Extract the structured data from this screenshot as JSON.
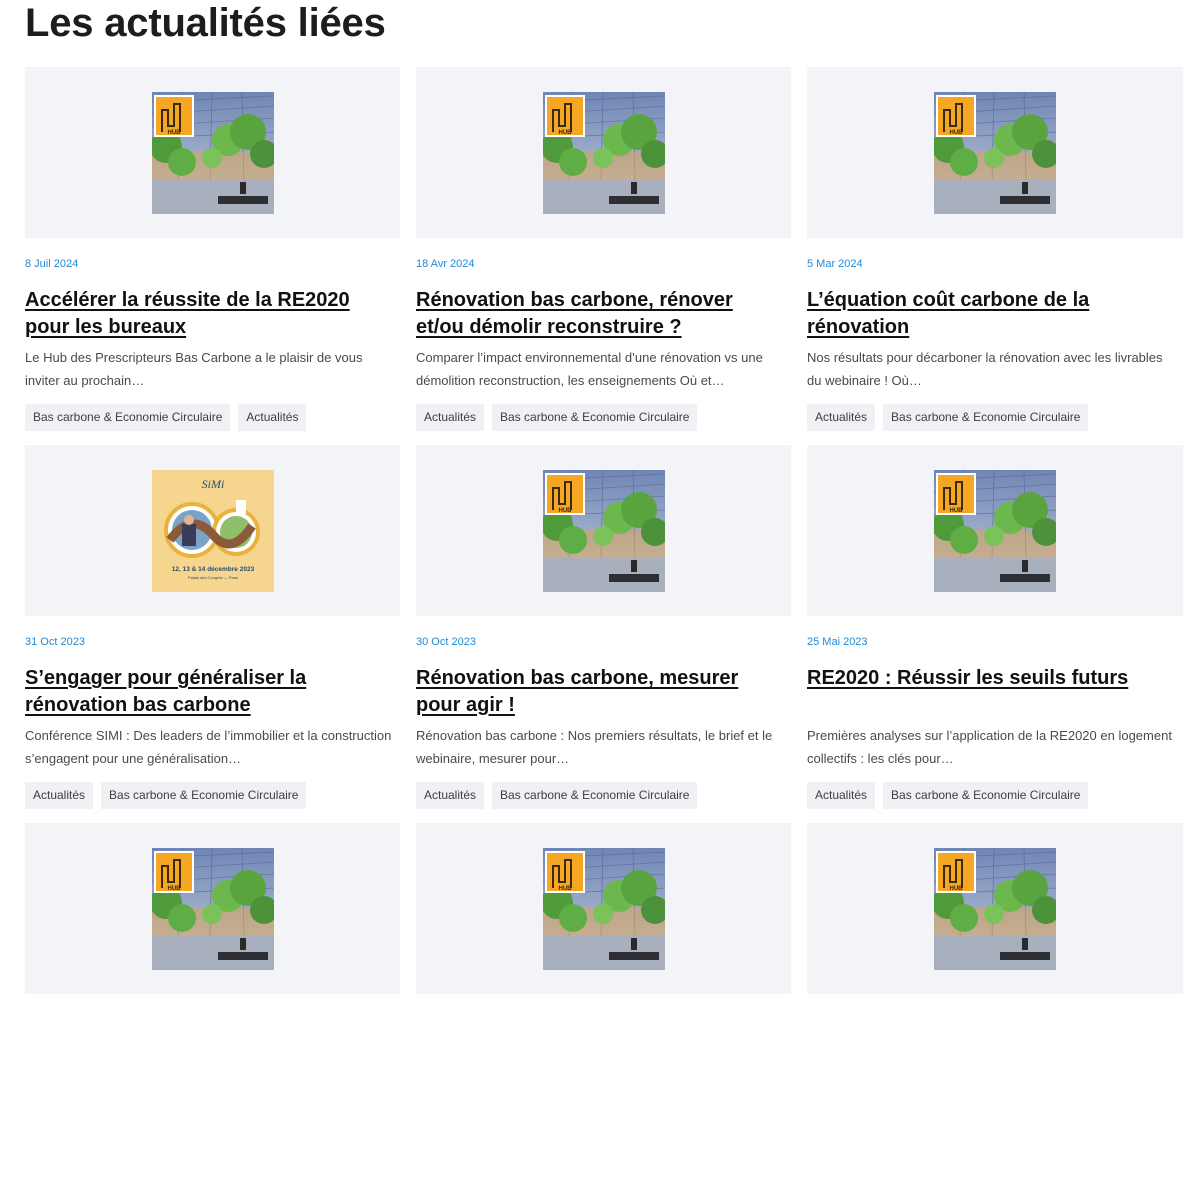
{
  "page": {
    "title": "Les actualités liées"
  },
  "colors": {
    "date": "#1e8ad6",
    "thumb_bg": "#f3f4f8",
    "tag_bg": "#f0f1f5"
  },
  "articles": [
    {
      "image": "hub-building-photo",
      "date": "8 Juil 2024",
      "title": "Accélérer la réussite de la RE2020 pour les bureaux",
      "excerpt": "Le Hub des Prescripteurs Bas Carbone a le plaisir de vous inviter au prochain…",
      "tags": [
        "Bas carbone & Economie Circulaire",
        "Actualités"
      ]
    },
    {
      "image": "hub-building-photo",
      "date": "18 Avr 2024",
      "title": "Rénovation bas carbone, rénover et/ou démolir reconstruire ?",
      "excerpt": "Comparer l’impact environnemental d’une rénovation vs une démolition reconstruction, les enseignements   Où et…",
      "tags": [
        "Actualités",
        "Bas carbone & Economie Circulaire"
      ]
    },
    {
      "image": "hub-building-photo",
      "date": "5 Mar 2024",
      "title": "L’équation coût carbone de la rénovation",
      "excerpt": "Nos résultats pour décarboner la rénovation avec les livrables du webinaire !   Où…",
      "tags": [
        "Actualités",
        "Bas carbone & Economie Circulaire"
      ]
    },
    {
      "image": "simi-poster",
      "poster_brand": "SiMi",
      "poster_dates": "12, 13 & 14 décembre 2023",
      "poster_place": "Palais des Congrès — Paris",
      "date": "31 Oct 2023",
      "title": "S’engager pour généraliser la rénovation bas carbone",
      "excerpt": "Conférence SIMI : Des leaders de l’immobilier et la construction s’engagent pour une généralisation…",
      "tags": [
        "Actualités",
        "Bas carbone & Economie Circulaire"
      ]
    },
    {
      "image": "hub-building-photo",
      "date": "30 Oct 2023",
      "title": "Rénovation bas carbone, mesurer pour agir !",
      "excerpt": "Rénovation bas carbone : Nos premiers résultats, le brief et le webinaire, mesurer pour…",
      "tags": [
        "Actualités",
        "Bas carbone & Economie Circulaire"
      ]
    },
    {
      "image": "hub-building-photo",
      "date": "25 Mai 2023",
      "title": "RE2020 : Réussir les seuils futurs",
      "excerpt": "Premières analyses sur l’application de la RE2020 en logement collectifs : les clés pour…",
      "tags": [
        "Actualités",
        "Bas carbone & Economie Circulaire"
      ]
    },
    {
      "image": "hub-building-photo",
      "date": "",
      "title": "",
      "excerpt": "",
      "tags": []
    },
    {
      "image": "hub-building-photo",
      "date": "",
      "title": "",
      "excerpt": "",
      "tags": []
    },
    {
      "image": "hub-building-photo",
      "date": "",
      "title": "",
      "excerpt": "",
      "tags": []
    }
  ]
}
